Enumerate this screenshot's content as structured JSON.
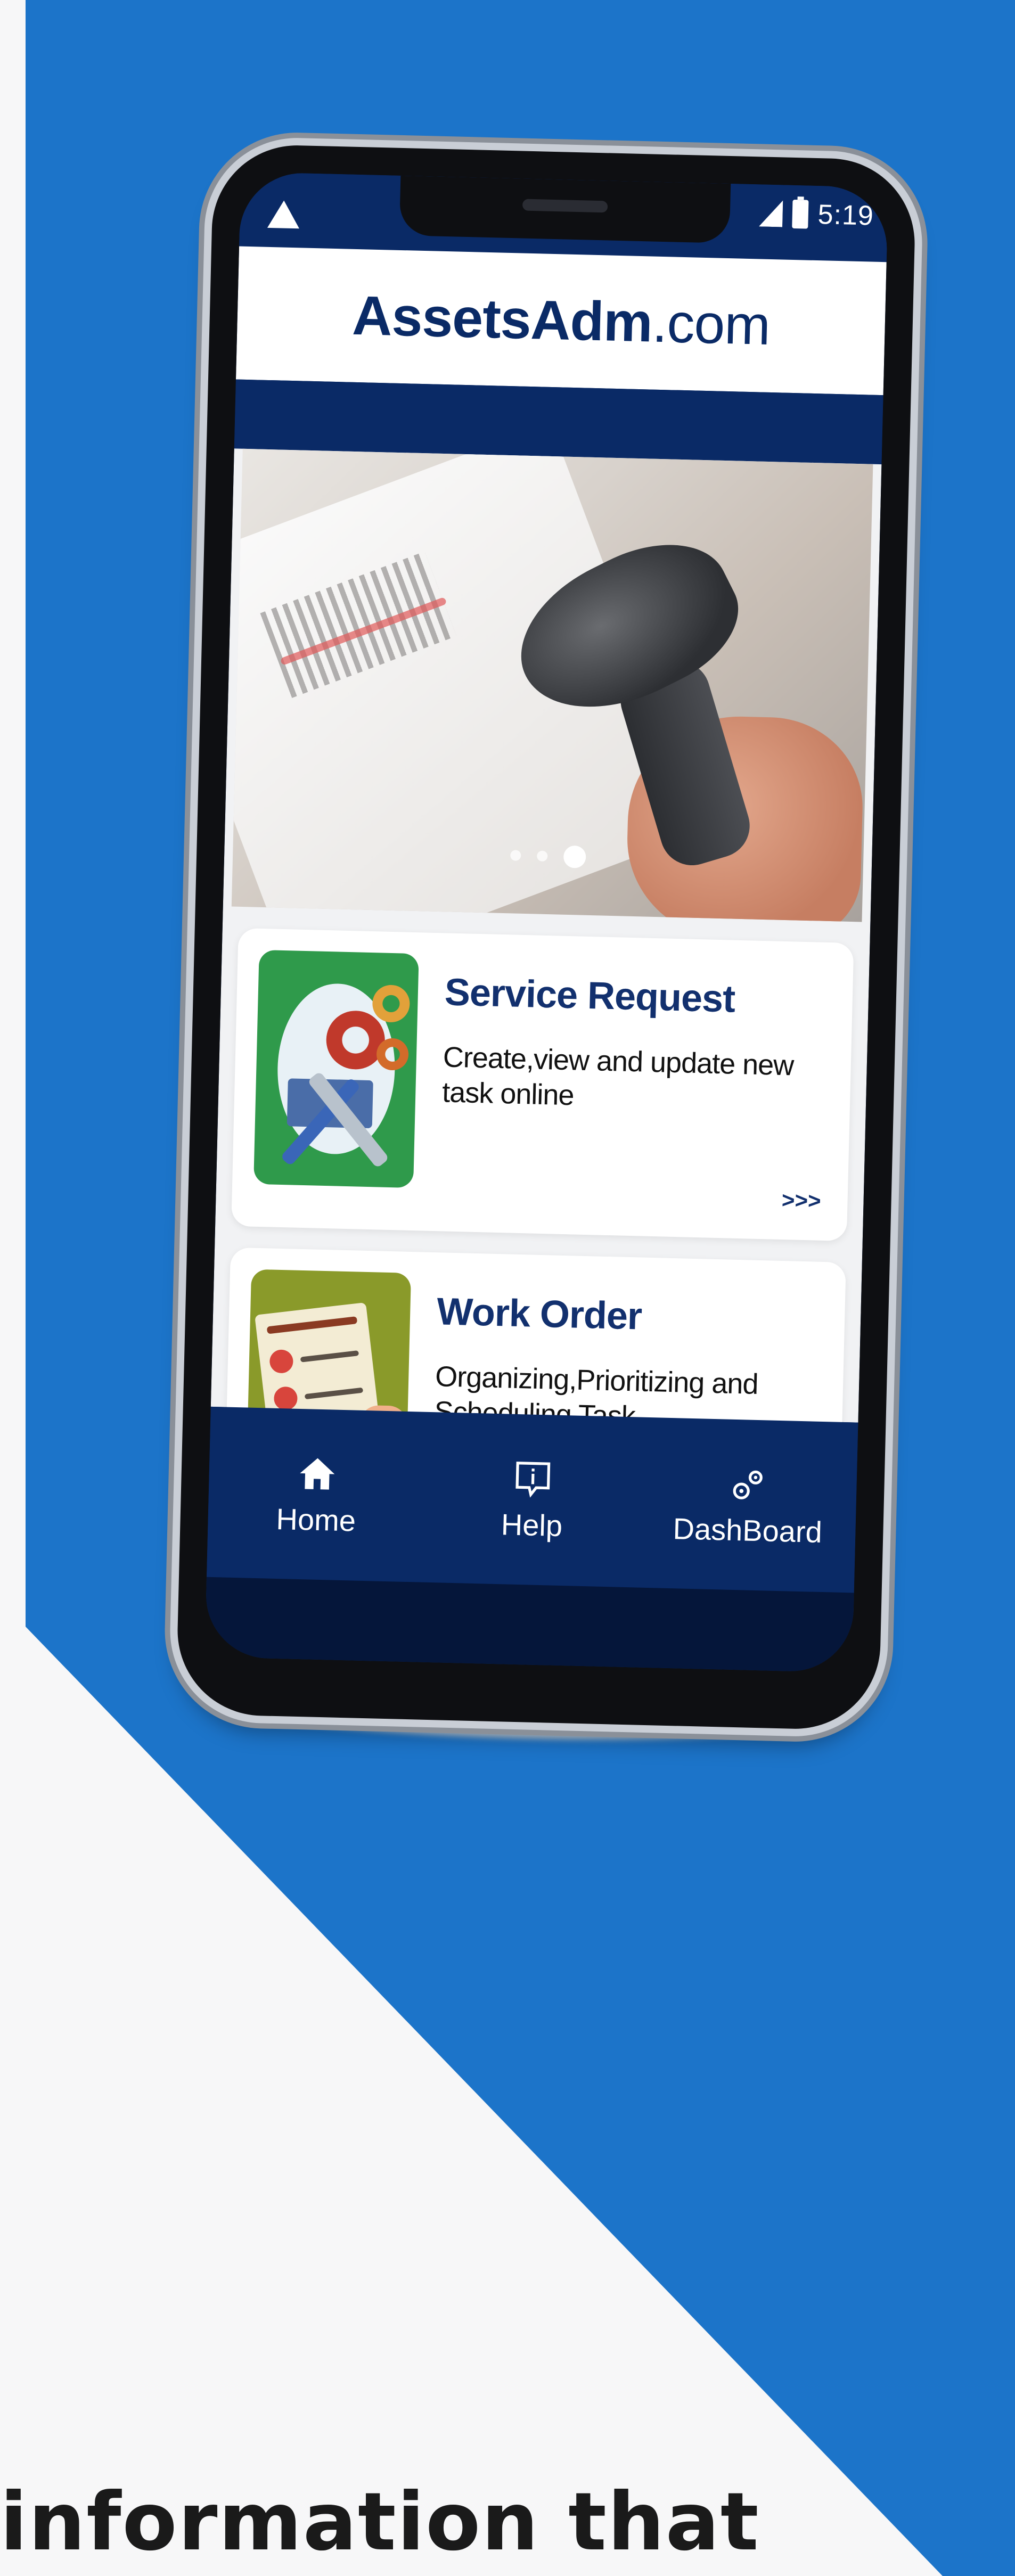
{
  "status_bar": {
    "time": "5:19",
    "left_icon": "warning-icon",
    "network_icon": "signal-icon",
    "battery_icon": "battery-charging-icon"
  },
  "header": {
    "logo_bold": "AssetsAdm",
    "logo_light": ".com"
  },
  "banner": {
    "slide_count": 3,
    "active_slide": 3
  },
  "cards": [
    {
      "title": "Service Request",
      "description": "Create,view and update new task online",
      "more": ">>>",
      "icon": "service-tools-icon"
    },
    {
      "title": "Work Order",
      "description": "Organizing,Prioritizing and Scheduling Task",
      "more": "",
      "icon": "checklist-icon"
    }
  ],
  "bottom_nav": {
    "items": [
      {
        "label": "Home",
        "icon": "home-icon"
      },
      {
        "label": "Help",
        "icon": "help-info-icon"
      },
      {
        "label": "DashBoard",
        "icon": "gears-icon"
      }
    ]
  },
  "caption": "information that",
  "colors": {
    "brand_blue": "#1c74c9",
    "app_navy": "#0a2a66",
    "page_background": "#f7f7f8"
  }
}
